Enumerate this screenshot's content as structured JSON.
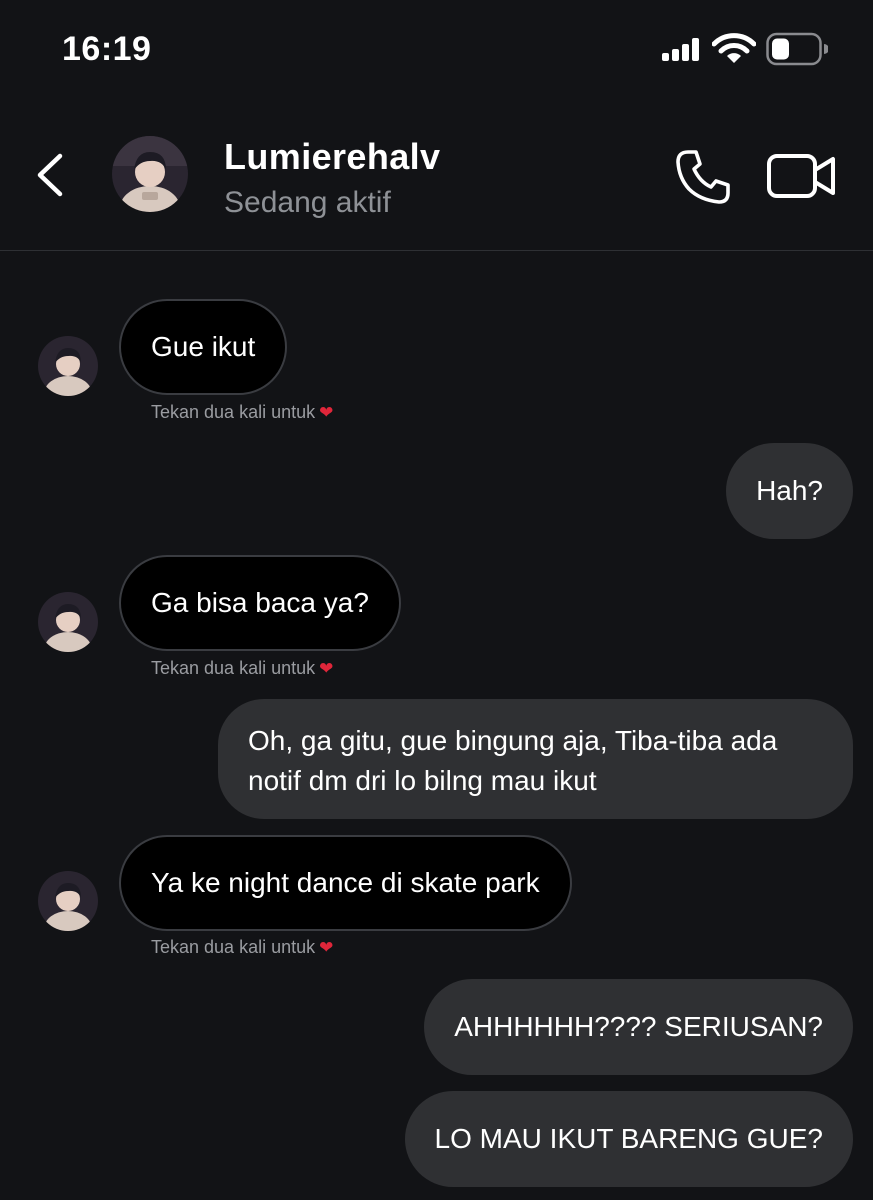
{
  "status_bar": {
    "time": "16:19"
  },
  "header": {
    "contact_name": "Lumierehalv",
    "contact_status": "Sedang aktif"
  },
  "messages": [
    {
      "direction": "incoming",
      "text": "Gue ikut",
      "hint": "Tekan dua kali untuk"
    },
    {
      "direction": "outgoing",
      "text": "Hah?"
    },
    {
      "direction": "incoming",
      "text": "Ga bisa baca ya?",
      "hint": "Tekan dua kali untuk"
    },
    {
      "direction": "outgoing",
      "text": "Oh, ga gitu, gue bingung aja, Tiba-tiba ada notif dm dri lo bilng mau ikut"
    },
    {
      "direction": "incoming",
      "text": "Ya ke night dance di skate park",
      "hint": "Tekan dua kali untuk"
    },
    {
      "direction": "outgoing",
      "text": "AHHHHHH???? SERIUSAN?"
    },
    {
      "direction": "outgoing",
      "text": "LO MAU IKUT BARENG GUE?"
    }
  ],
  "icons": {
    "back": "chevron-left-icon",
    "phone": "phone-icon",
    "video": "video-camera-icon",
    "heart": "heart-icon"
  },
  "colors": {
    "background": "#121316",
    "incoming_bubble": "#000000",
    "outgoing_bubble": "#2f3033",
    "heart": "#e0263a",
    "muted_text": "#8e9196"
  }
}
